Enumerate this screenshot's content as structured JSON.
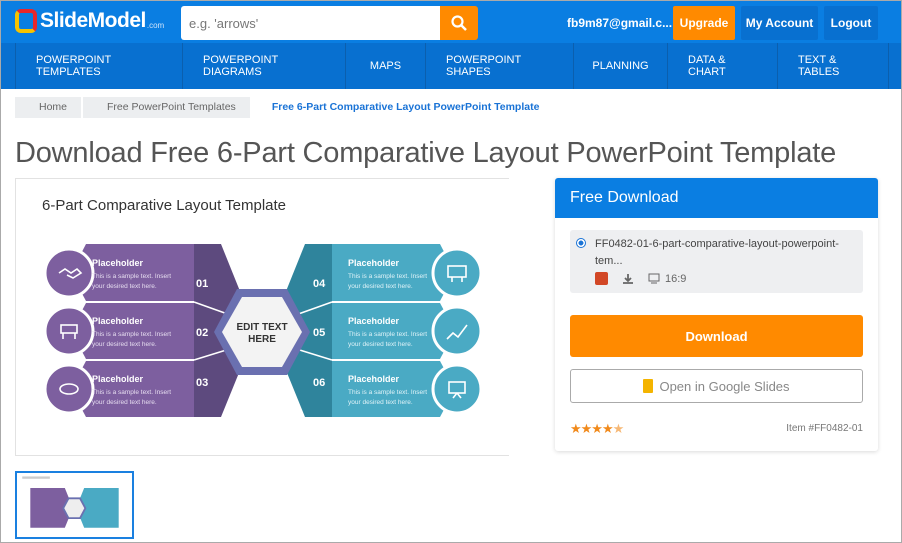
{
  "header": {
    "logo": "SlideModel",
    "logo_suffix": ".com",
    "search_placeholder": "e.g. 'arrows'",
    "email": "fb9m87@gmail.c...",
    "upgrade": "Upgrade",
    "my_account": "My Account",
    "logout": "Logout"
  },
  "nav": [
    "POWERPOINT TEMPLATES",
    "POWERPOINT DIAGRAMS",
    "MAPS",
    "POWERPOINT SHAPES",
    "PLANNING",
    "DATA & CHART",
    "TEXT & TABLES"
  ],
  "breadcrumb": [
    "Home",
    "Free PowerPoint Templates",
    "Free 6-Part Comparative Layout PowerPoint Template"
  ],
  "page_title": "Download Free 6-Part Comparative Layout PowerPoint Template",
  "slide": {
    "title": "6-Part Comparative Layout Template",
    "center": [
      "EDIT TEXT",
      "HERE"
    ],
    "items": [
      {
        "num": "01",
        "heading": "Placeholder",
        "line1": "This is a sample text. Insert",
        "line2": "your desired text here."
      },
      {
        "num": "02",
        "heading": "Placeholder",
        "line1": "This is a sample text. Insert",
        "line2": "your desired text here."
      },
      {
        "num": "03",
        "heading": "Placeholder",
        "line1": "This is a sample text. Insert",
        "line2": "your desired text here."
      },
      {
        "num": "04",
        "heading": "Placeholder",
        "line1": "This is a sample text. Insert",
        "line2": "your desired text here."
      },
      {
        "num": "05",
        "heading": "Placeholder",
        "line1": "This is a sample text. Insert",
        "line2": "your desired text here."
      },
      {
        "num": "06",
        "heading": "Placeholder",
        "line1": "This is a sample text. Insert",
        "line2": "your desired text here."
      }
    ],
    "colors": {
      "purple": "#7d5f9f",
      "purple_dark": "#5d4a7e",
      "teal": "#4aaac4",
      "teal_dark": "#2f849c"
    }
  },
  "download_panel": {
    "title": "Free Download",
    "file_name": "FF0482-01-6-part-comparative-layout-powerpoint-tem...",
    "aspect": "16:9",
    "download": "Download",
    "google_slides": "Open in Google Slides",
    "rating": 4.5,
    "item_id": "Item #FF0482-01"
  },
  "colors": {
    "brand_blue": "#0a7ee2",
    "accent_orange": "#ff8a00"
  }
}
